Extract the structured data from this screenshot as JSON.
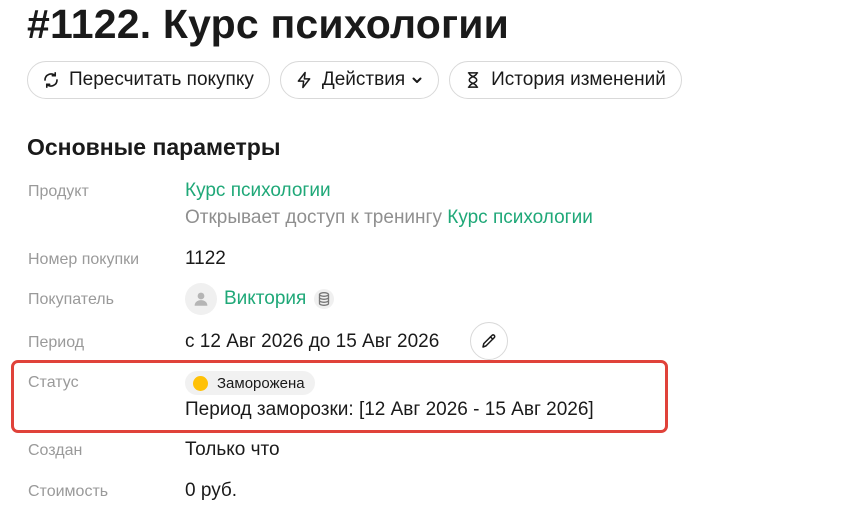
{
  "page": {
    "title": "#1122. Курс психологии"
  },
  "toolbar": {
    "recalc_label": "Пересчитать покупку",
    "actions_label": "Действия",
    "history_label": "История изменений"
  },
  "section": {
    "title": "Основные параметры"
  },
  "fields": {
    "product": {
      "label": "Продукт",
      "value": "Курс психологии",
      "desc_prefix": "Открывает доступ к тренингу ",
      "desc_link": "Курс психологии"
    },
    "purchase_number": {
      "label": "Номер покупки",
      "value": "1122"
    },
    "buyer": {
      "label": "Покупатель",
      "value": "Виктория"
    },
    "period": {
      "label": "Период",
      "value": "с 12 Авг 2026 до 15 Авг 2026"
    },
    "status": {
      "label": "Статус",
      "value": "Заморожена",
      "dot_color": "#ffc107",
      "freeze_period": "Период заморозки: [12 Авг 2026 - 15 Авг 2026]"
    },
    "created": {
      "label": "Создан",
      "value": "Только что"
    },
    "cost": {
      "label": "Стоимость",
      "value": "0 руб."
    }
  },
  "colors": {
    "link": "#1fa878",
    "highlight": "#e0423a",
    "label": "#9a9a9a"
  }
}
